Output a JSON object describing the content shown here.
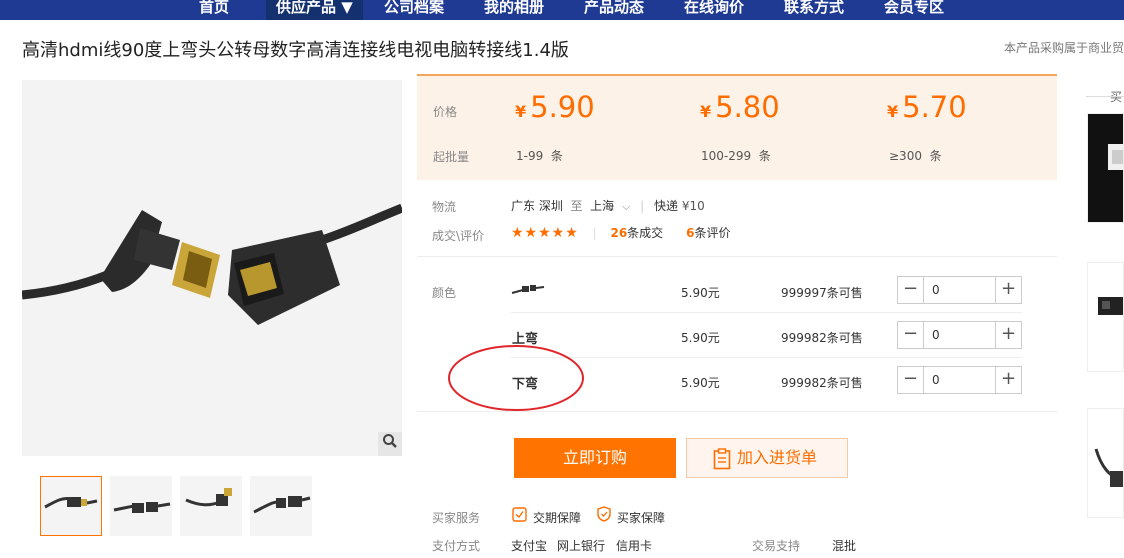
{
  "nav": [
    "首页",
    "供应产品 ▼",
    "公司档案",
    "我的相册",
    "产品动态",
    "在线询价",
    "联系方式",
    "会员专区"
  ],
  "product": {
    "title": "高清hdmi线90度上弯头公转母数字高清连接线电视电脑转接线1.4版",
    "notice": "本产品采购属于商业贸"
  },
  "pricing": {
    "price_label": "价格",
    "moq_label": "起批量",
    "currency": "¥",
    "tiers": [
      {
        "price": "5.90",
        "range": "1-99",
        "unit": "条"
      },
      {
        "price": "5.80",
        "range": "100-299",
        "unit": "条"
      },
      {
        "price": "5.70",
        "range": "≥300",
        "unit": "条"
      }
    ]
  },
  "logistics": {
    "label": "物流",
    "from": "广东 深圳",
    "to_word": "至",
    "to": "上海",
    "method": "快递",
    "fee": "¥10"
  },
  "deals": {
    "label": "成交\\评价",
    "stars": "★★★★★",
    "deal_count": "26",
    "deal_text": "条成交",
    "review_count": "6",
    "review_text": "条评价"
  },
  "sku": {
    "label": "颜色",
    "items": [
      {
        "name": "",
        "price": "5.90元",
        "stock": "999997条可售",
        "qty": "0"
      },
      {
        "name": "上弯",
        "price": "5.90元",
        "stock": "999982条可售",
        "qty": "0"
      },
      {
        "name": "下弯",
        "price": "5.90元",
        "stock": "999982条可售",
        "qty": "0"
      }
    ]
  },
  "buttons": {
    "buy": "立即订购",
    "cart": "加入进货单"
  },
  "services": {
    "label": "买家服务",
    "items": [
      "交期保障",
      "买家保障"
    ]
  },
  "payment": {
    "label": "支付方式",
    "methods": [
      "支付宝",
      "网上银行",
      "信用卡"
    ],
    "support_label": "交易支持",
    "support_value": "混批"
  },
  "sidebar": {
    "header": "买"
  },
  "colors": {
    "accent": "#ff6d00",
    "nav": "#1f3a93",
    "price_bg": "#fdf2e8",
    "annotation": "#e0262a"
  }
}
